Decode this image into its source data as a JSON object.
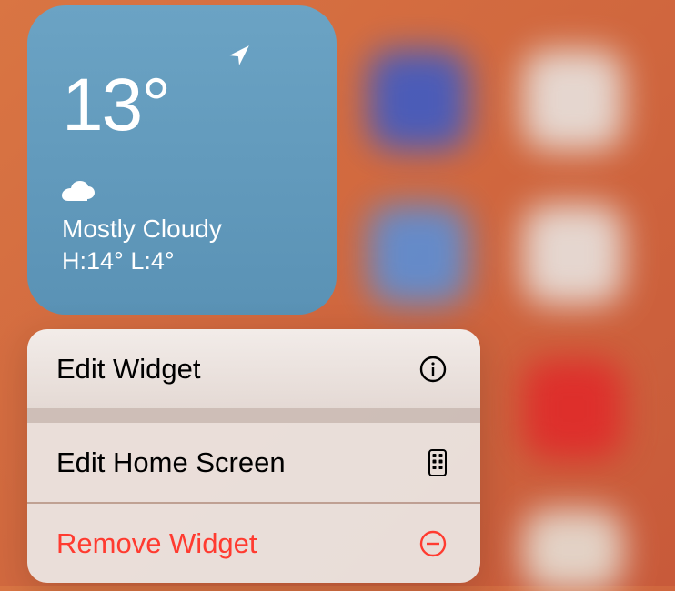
{
  "weather": {
    "temperature": "13°",
    "condition": "Mostly Cloudy",
    "high_low": "H:14° L:4°"
  },
  "menu": {
    "items": [
      {
        "label": "Edit Widget",
        "icon": "info-circle"
      },
      {
        "label": "Edit Home Screen",
        "icon": "home-screen"
      },
      {
        "label": "Remove Widget",
        "icon": "minus-circle",
        "destructive": true
      }
    ]
  },
  "colors": {
    "destructive": "#ff3b30",
    "widget_bg_top": "#6ba3c4",
    "widget_bg_bottom": "#5a92b5"
  }
}
